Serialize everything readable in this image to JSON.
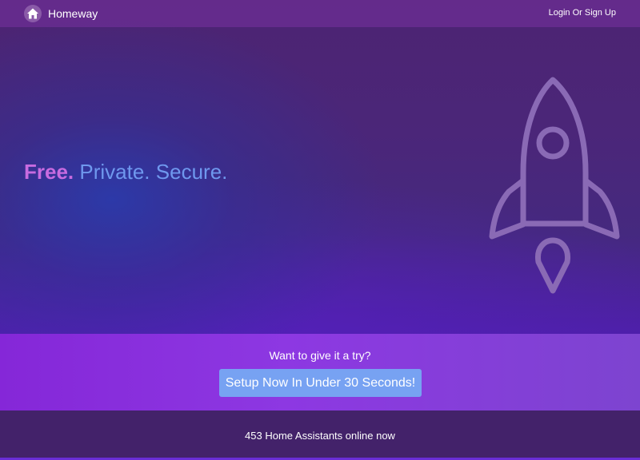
{
  "header": {
    "brand_name": "Homeway",
    "logo_icon": "home-icon",
    "login_label": "Login Or Sign Up"
  },
  "hero": {
    "tagline": {
      "word1": "Free.",
      "word2": "Private.",
      "word3": "Secure."
    },
    "illustration_icon": "rocket-icon"
  },
  "cta": {
    "question": "Want to give it a try?",
    "button_label": "Setup Now In Under 30 Seconds!"
  },
  "footer": {
    "status_text": "453 Home Assistants online now"
  },
  "colors": {
    "accent_pink": "#c86be0",
    "accent_blue": "#6f98ee",
    "button_bg": "#77a2f2",
    "cta_band": "#8a30dc",
    "footer_bg": "#43226a"
  }
}
